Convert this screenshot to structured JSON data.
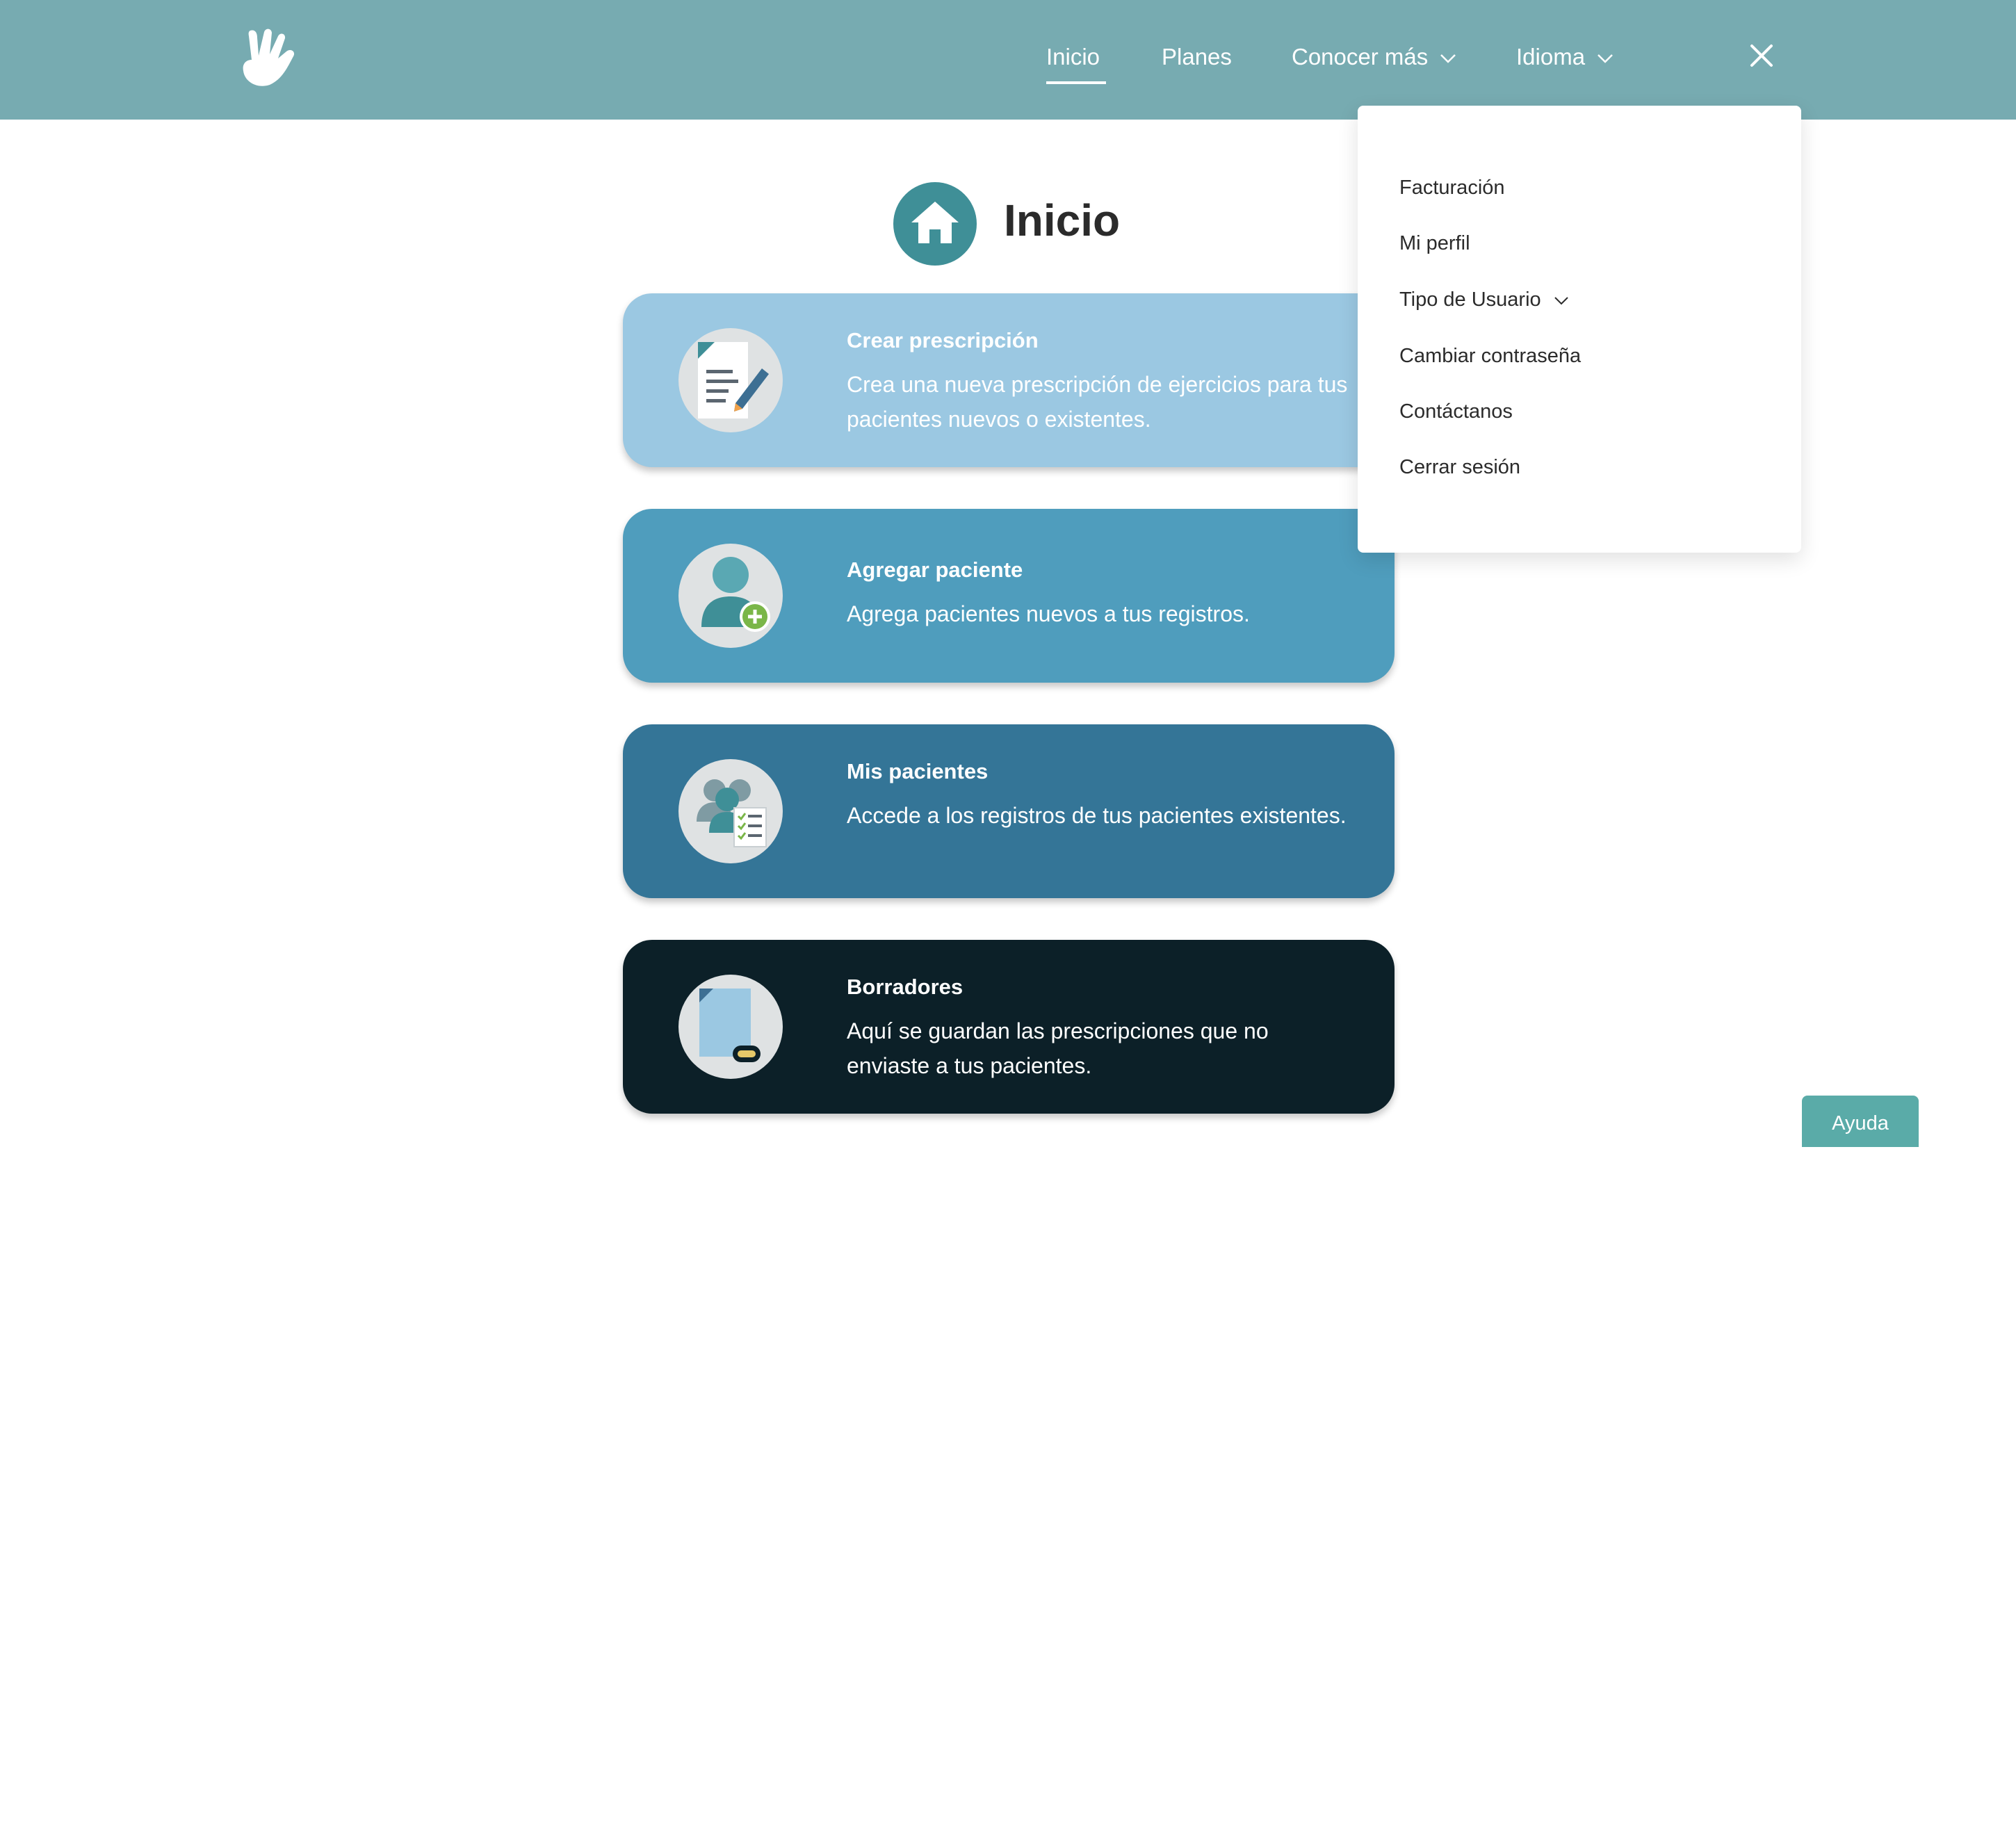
{
  "nav": {
    "items": [
      {
        "label": "Inicio"
      },
      {
        "label": "Planes"
      },
      {
        "label": "Conocer más"
      },
      {
        "label": "Idioma"
      }
    ]
  },
  "page": {
    "title": "Inicio"
  },
  "cards": [
    {
      "title": "Crear prescripción",
      "description": "Crea una nueva prescripción de ejercicios para tus pacientes nuevos o existentes.",
      "color": "#9bc8e2"
    },
    {
      "title": "Agregar paciente",
      "description": "Agrega pacientes nuevos a tus registros.",
      "color": "#4f9dbd"
    },
    {
      "title": "Mis pacientes",
      "description": "Accede a los registros de tus pacientes existentes.",
      "color": "#347597"
    },
    {
      "title": "Borradores",
      "description": "Aquí se guardan las prescripciones que no enviaste a tus pacientes.",
      "color": "#0c2028"
    }
  ],
  "dropdown": {
    "items": [
      {
        "label": "Facturación"
      },
      {
        "label": "Mi perfil"
      },
      {
        "label": "Tipo de Usuario"
      },
      {
        "label": "Cambiar contraseña"
      },
      {
        "label": "Contáctanos"
      },
      {
        "label": "Cerrar sesión"
      }
    ]
  },
  "help": {
    "label": "Ayuda"
  },
  "colors": {
    "navbar": "#77abb1",
    "accent": "#3f8f97",
    "help_button": "#5aaba8"
  },
  "icons": {
    "logo": "hand-logo-icon",
    "close": "close-icon",
    "home": "home-icon",
    "chevron": "chevron-down-icon",
    "cards": [
      "prescription-document-icon",
      "add-patient-icon",
      "patients-list-icon",
      "drafts-document-icon"
    ]
  }
}
